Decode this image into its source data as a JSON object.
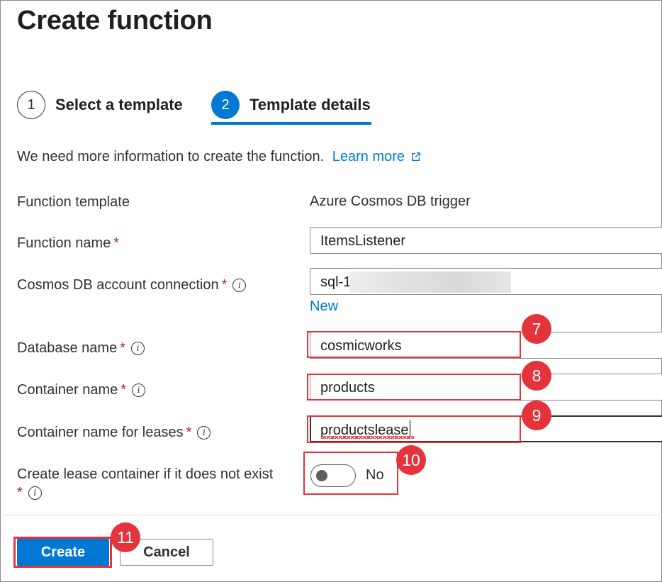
{
  "title": "Create function",
  "steps": [
    {
      "number": "1",
      "label": "Select a template"
    },
    {
      "number": "2",
      "label": "Template details"
    }
  ],
  "intro": {
    "text": "We need more information to create the function.",
    "link": "Learn more"
  },
  "form": {
    "function_template": {
      "label": "Function template",
      "value": "Azure Cosmos DB trigger"
    },
    "function_name": {
      "label": "Function name",
      "value": "ItemsListener"
    },
    "cosmos_connection": {
      "label": "Cosmos DB account connection",
      "value": "sql-1",
      "new_link": "New"
    },
    "database_name": {
      "label": "Database name",
      "value": "cosmicworks"
    },
    "container_name": {
      "label": "Container name",
      "value": "products"
    },
    "lease_container": {
      "label": "Container name for leases",
      "value": "productslease"
    },
    "create_lease": {
      "label": "Create lease container if it does not exist",
      "toggle_text": "No",
      "enabled": false
    }
  },
  "required_mark": "*",
  "info_glyph": "i",
  "callouts": [
    "7",
    "8",
    "9",
    "10",
    "11"
  ],
  "buttons": {
    "create": "Create",
    "cancel": "Cancel"
  },
  "colors": {
    "accent": "#0078d4",
    "callout": "#e3343c"
  }
}
